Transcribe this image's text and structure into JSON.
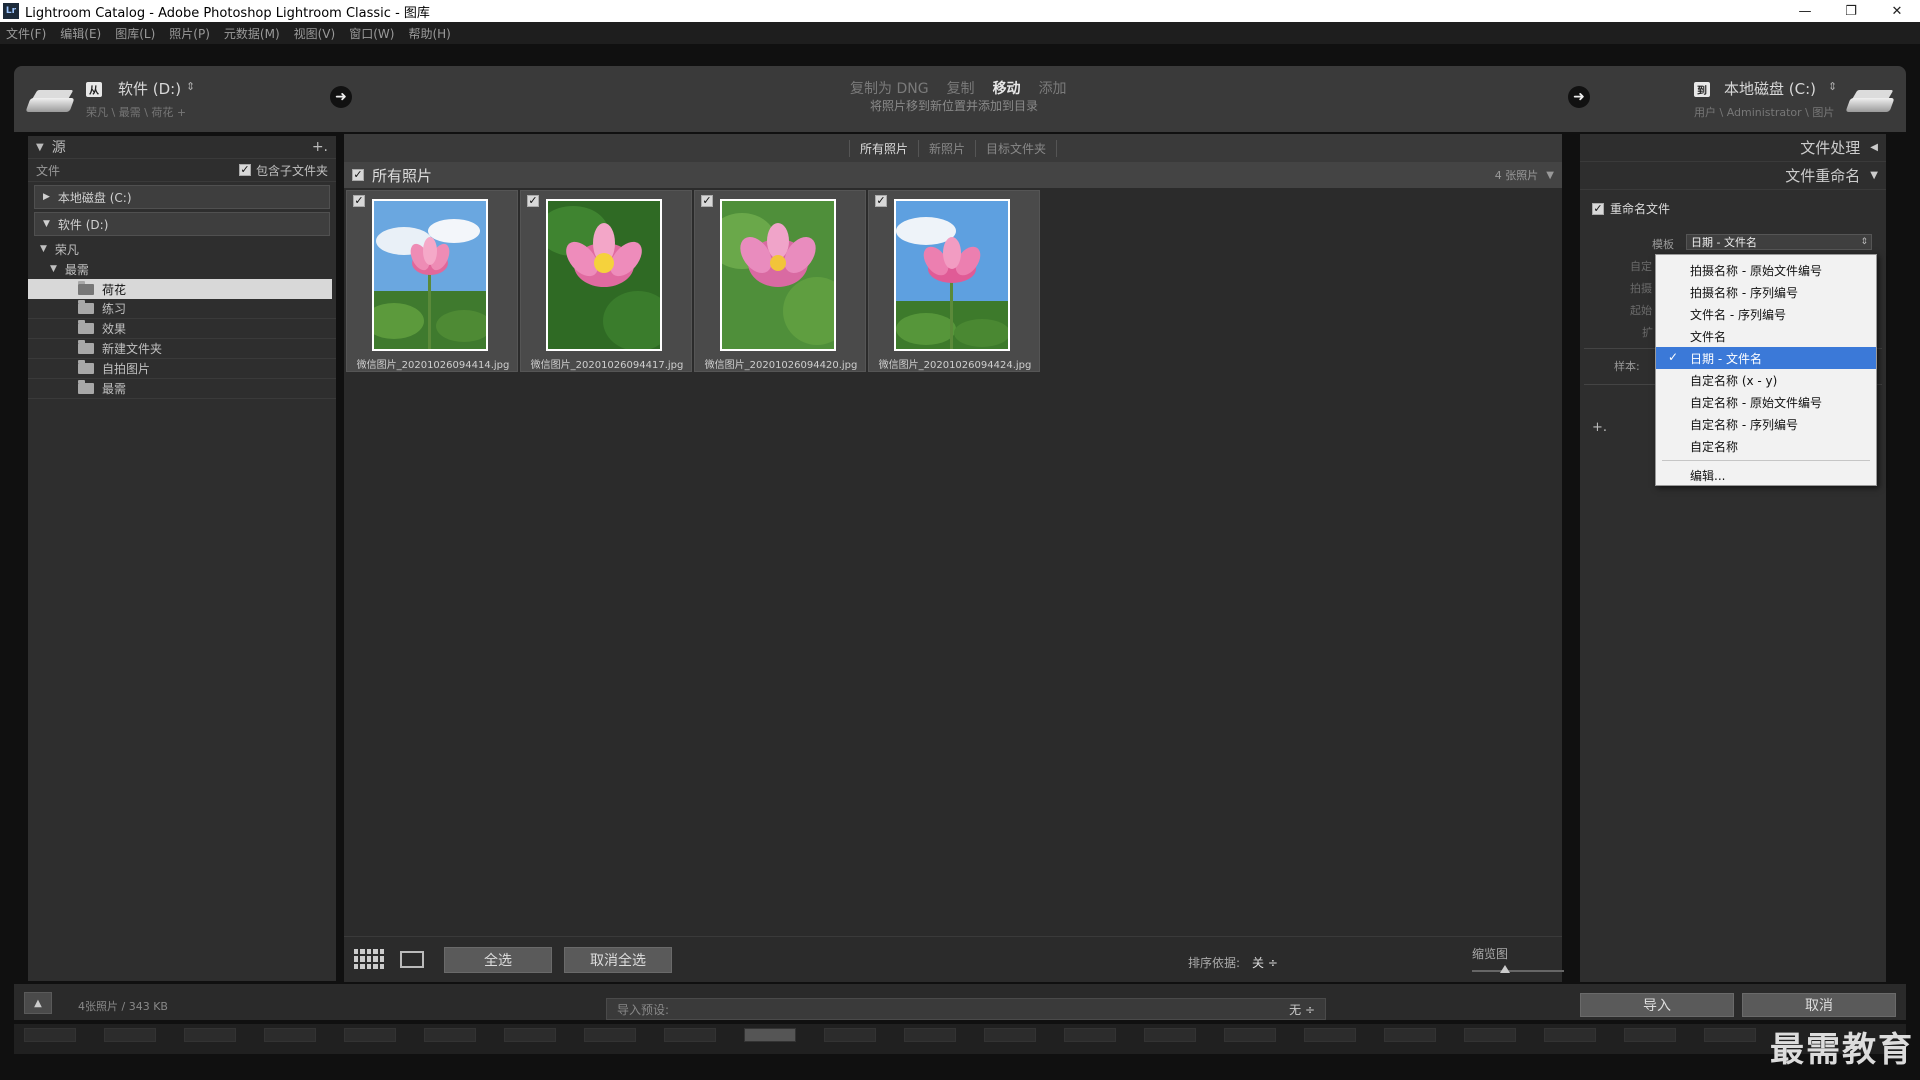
{
  "window": {
    "title": "Lightroom Catalog - Adobe Photoshop Lightroom Classic - 图库",
    "icon_text": "Lr",
    "controls": [
      "—",
      "❐",
      "✕"
    ]
  },
  "menu": [
    "文件(F)",
    "编辑(E)",
    "图库(L)",
    "照片(P)",
    "元数据(M)",
    "视图(V)",
    "窗口(W)",
    "帮助(H)"
  ],
  "import_header": {
    "source_tag": "从",
    "source_label": "软件 (D:)",
    "source_path": "荣凡 \\ 最需 \\ 荷花 +",
    "modes": [
      {
        "label": "复制为 DNG",
        "active": false
      },
      {
        "label": "复制",
        "active": false
      },
      {
        "label": "移动",
        "active": true
      },
      {
        "label": "添加",
        "active": false
      }
    ],
    "mode_desc": "将照片移到新位置并添加到目录",
    "dest_tag": "到",
    "dest_label": "本地磁盘 (C:)",
    "dest_path": "用户 \\ Administrator \\ 图片"
  },
  "left_panel": {
    "header": "源",
    "files_label": "文件",
    "include_subfolders": "包含子文件夹",
    "drives": [
      "本地磁盘 (C:)",
      "软件 (D:)"
    ],
    "tree": {
      "root": "荣凡",
      "child": "最需",
      "folders": [
        "荷花",
        "练习",
        "效果",
        "新建文件夹",
        "自拍图片",
        "最需"
      ],
      "selected": "荷花"
    }
  },
  "center": {
    "filter_tabs": [
      "所有照片",
      "新照片",
      "目标文件夹"
    ],
    "active_tab": "所有照片",
    "grid_title": "所有照片",
    "photo_count": "4 张照片",
    "photos": [
      {
        "name": "微信图片_20201026094414.jpg",
        "checked": true
      },
      {
        "name": "微信图片_20201026094417.jpg",
        "checked": true
      },
      {
        "name": "微信图片_20201026094420.jpg",
        "checked": true
      },
      {
        "name": "微信图片_20201026094424.jpg",
        "checked": true
      }
    ],
    "toolbar": {
      "select_all": "全选",
      "deselect_all": "取消全选",
      "sort_label": "排序依据:",
      "sort_value": "关 ÷",
      "thumb_label": "缩览图"
    }
  },
  "right_panel": {
    "file_handling": "文件处理",
    "file_rename": "文件重命名",
    "rename_files": "重命名文件",
    "template_label": "模板",
    "template_value": "日期 - 文件名",
    "dim_labels": [
      "自定",
      "拍摄",
      "起始",
      "扩"
    ],
    "sample_label": "样本:",
    "plus_label": "+."
  },
  "dropdown": {
    "items": [
      "拍摄名称 - 原始文件编号",
      "拍摄名称 - 序列编号",
      "文件名 - 序列编号",
      "文件名",
      "日期 - 文件名",
      "自定名称 (x - y)",
      "自定名称 - 原始文件编号",
      "自定名称 - 序列编号",
      "自定名称"
    ],
    "selected_index": 4,
    "edit_item": "编辑..."
  },
  "bottom": {
    "status": "4张照片 / 343 KB",
    "preset_label": "导入预设:",
    "preset_value": "无 ÷",
    "import_button": "导入",
    "cancel_button": "取消"
  },
  "watermark": "最需教育",
  "colors": {
    "selection_blue": "#3b79d8",
    "panel_bg": "#2e2e2e",
    "header_bg": "#3a3a3a"
  }
}
